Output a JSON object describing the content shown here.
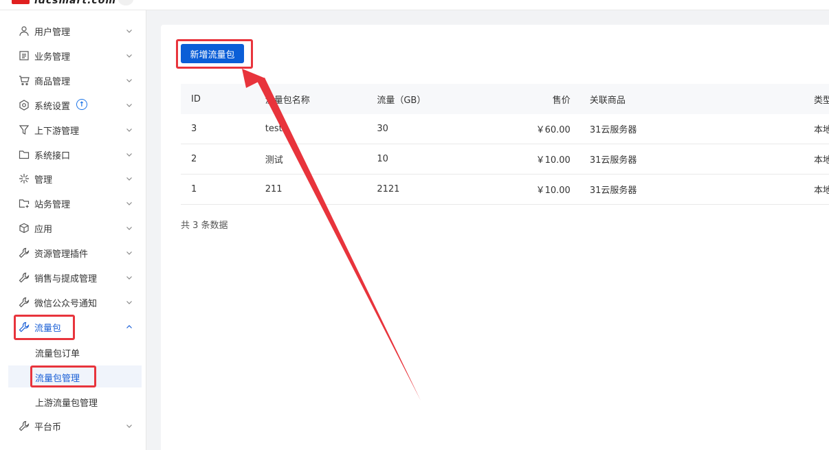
{
  "header": {
    "logo_text": "idcsmart.com"
  },
  "sidebar": {
    "items": [
      {
        "label": "用户管理",
        "icon": "user-icon"
      },
      {
        "label": "业务管理",
        "icon": "list-icon"
      },
      {
        "label": "商品管理",
        "icon": "cart-icon"
      },
      {
        "label": "系统设置",
        "icon": "settings-icon",
        "badge": "upgrade-icon"
      },
      {
        "label": "上下游管理",
        "icon": "filter-icon"
      },
      {
        "label": "系统接口",
        "icon": "folder-icon"
      },
      {
        "label": "管理",
        "icon": "sparkle-icon"
      },
      {
        "label": "站务管理",
        "icon": "folder-add-icon"
      },
      {
        "label": "应用",
        "icon": "cube-icon"
      },
      {
        "label": "资源管理插件",
        "icon": "wrench-icon"
      },
      {
        "label": "销售与提成管理",
        "icon": "wrench-icon"
      },
      {
        "label": "微信公众号通知",
        "icon": "wrench-icon"
      },
      {
        "label": "流量包",
        "icon": "wrench-icon",
        "expanded": true
      },
      {
        "label": "平台币",
        "icon": "wrench-icon"
      }
    ],
    "sub_items": [
      {
        "label": "流量包订单"
      },
      {
        "label": "流量包管理",
        "selected": true
      },
      {
        "label": "上游流量包管理"
      }
    ]
  },
  "main": {
    "add_button_label": "新增流量包",
    "table": {
      "columns": [
        "ID",
        "流量包名称",
        "流量（GB）",
        "售价",
        "关联商品",
        "类型"
      ],
      "rows": [
        {
          "id": "3",
          "name": "test",
          "flow": "30",
          "price": "￥60.00",
          "product": "31云服务器",
          "type": "本地流"
        },
        {
          "id": "2",
          "name": "测试",
          "flow": "10",
          "price": "￥10.00",
          "product": "31云服务器",
          "type": "本地流"
        },
        {
          "id": "1",
          "name": "211",
          "flow": "2121",
          "price": "￥10.00",
          "product": "31云服务器",
          "type": "本地流"
        }
      ]
    },
    "total_text": "共 3 条数据"
  },
  "colors": {
    "accent": "#0b5ed7",
    "highlight": "#e8343c",
    "active_text": "#1a5fd6"
  }
}
